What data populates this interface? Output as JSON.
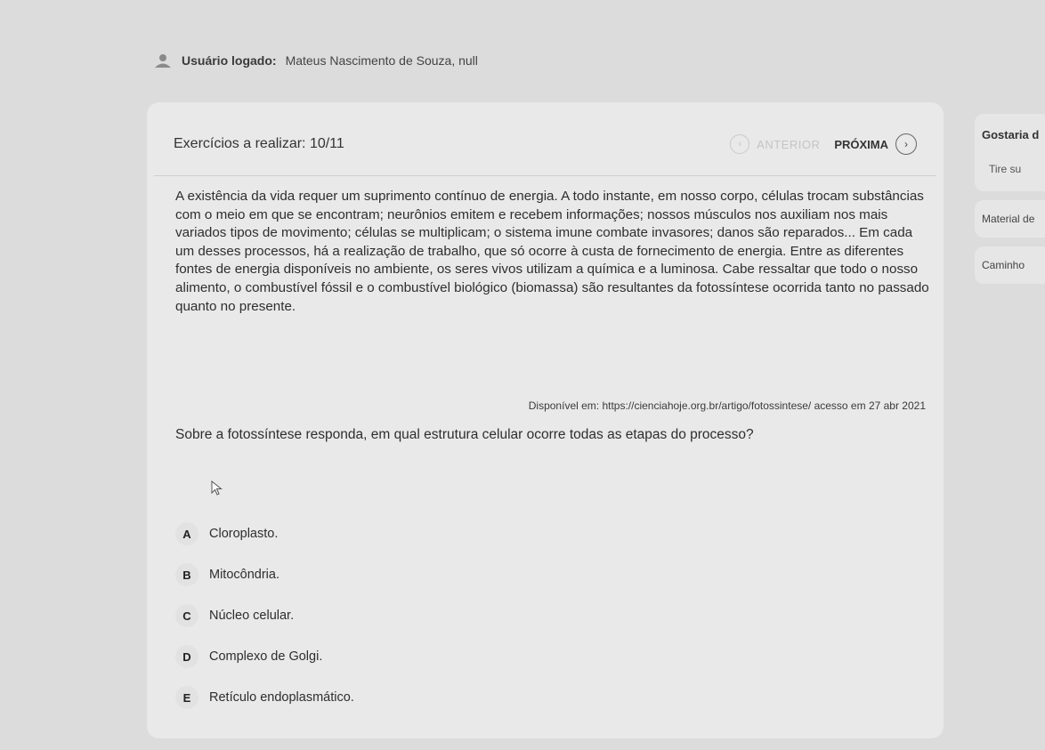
{
  "user": {
    "label": "Usuário logado:",
    "name": "Mateus Nascimento de Souza, null"
  },
  "exercise": {
    "counter": "Exercícios a realizar: 10/11",
    "prev_label": "ANTERIOR",
    "next_label": "PRÓXIMA"
  },
  "passage": "A existência da vida requer um suprimento contínuo de energia. A todo instante, em nosso corpo, células trocam substâncias com o meio em que se encontram; neurônios emitem e recebem informações; nossos músculos nos auxiliam nos mais variados tipos de movimento; células se multiplicam; o sistema imune combate invasores; danos são reparados... Em cada um desses processos, há a realização de trabalho, que só ocorre à custa de fornecimento de energia. Entre as diferentes fontes de energia disponíveis no ambiente, os seres vivos utilizam a química e a luminosa. Cabe ressaltar que todo o nosso alimento, o combustível fóssil e o combustível biológico (biomassa) são resultantes da fotossíntese ocorrida tanto no passado quanto no presente.",
  "source": "Disponível em: https://cienciahoje.org.br/artigo/fotossintese/ acesso em 27 abr 2021",
  "question": "Sobre a fotossíntese responda, em qual estrutura celular ocorre todas as etapas do processo?",
  "options": [
    {
      "letter": "A",
      "text": "Cloroplasto."
    },
    {
      "letter": "B",
      "text": "Mitocôndria."
    },
    {
      "letter": "C",
      "text": "Núcleo celular."
    },
    {
      "letter": "D",
      "text": "Complexo de Golgi."
    },
    {
      "letter": "E",
      "text": "Retículo endoplasmático."
    }
  ],
  "sidebar": {
    "panel_title": "Gostaria d",
    "panel_sub": "Tire su",
    "material": "Material de",
    "path": "Caminho"
  },
  "icons": {
    "user": "user-icon",
    "prev": "chevron-left-icon",
    "next": "chevron-right-icon",
    "cursor": "mouse-pointer-icon"
  }
}
